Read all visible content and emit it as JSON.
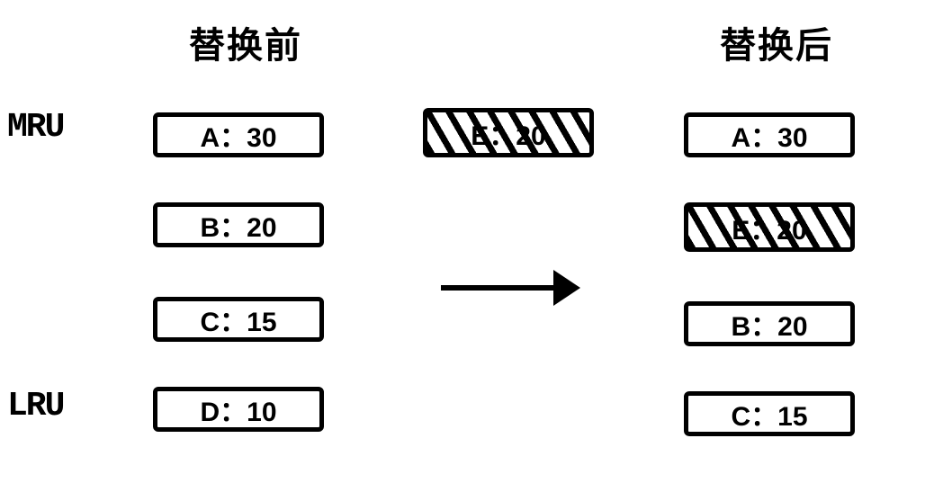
{
  "headings": {
    "before": "替换前",
    "after": "替换后"
  },
  "side_labels": {
    "mru": "MRU",
    "lru": "LRU"
  },
  "before_list": {
    "row1": "A：30",
    "row2": "B：20",
    "row3": "C：15",
    "row4": "D：10"
  },
  "incoming": {
    "value": "E：20"
  },
  "after_list": {
    "row1": "A：30",
    "row2": "E：20",
    "row3": "B：20",
    "row4": "C：15"
  },
  "chart_data": {
    "type": "table",
    "description": "Cache replacement diagram showing MRU-to-LRU ordering before and after inserting a new element E (priority 20). Lowest-priority element D (10) is evicted; E is placed below A (30) per its priority.",
    "before": [
      {
        "key": "A",
        "value": 30
      },
      {
        "key": "B",
        "value": 20
      },
      {
        "key": "C",
        "value": 15
      },
      {
        "key": "D",
        "value": 10
      }
    ],
    "inserted": {
      "key": "E",
      "value": 20
    },
    "after": [
      {
        "key": "A",
        "value": 30
      },
      {
        "key": "E",
        "value": 20
      },
      {
        "key": "B",
        "value": 20
      },
      {
        "key": "C",
        "value": 15
      }
    ],
    "labels": {
      "top": "MRU",
      "bottom": "LRU",
      "before_heading": "替换前",
      "after_heading": "替换后"
    }
  }
}
